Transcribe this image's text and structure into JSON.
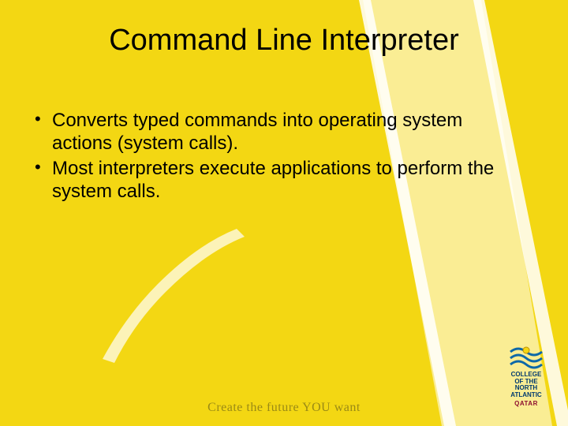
{
  "title": "Command Line Interpreter",
  "bullets": [
    "Converts typed commands into operating system actions (system calls).",
    "Most interpreters execute applications to perform the system calls."
  ],
  "tagline": "Create the future YOU want",
  "logo": {
    "line1": "COLLEGE",
    "line2": "OF THE",
    "line3": "NORTH",
    "line4": "ATLANTIC",
    "qatar": "QATAR"
  }
}
